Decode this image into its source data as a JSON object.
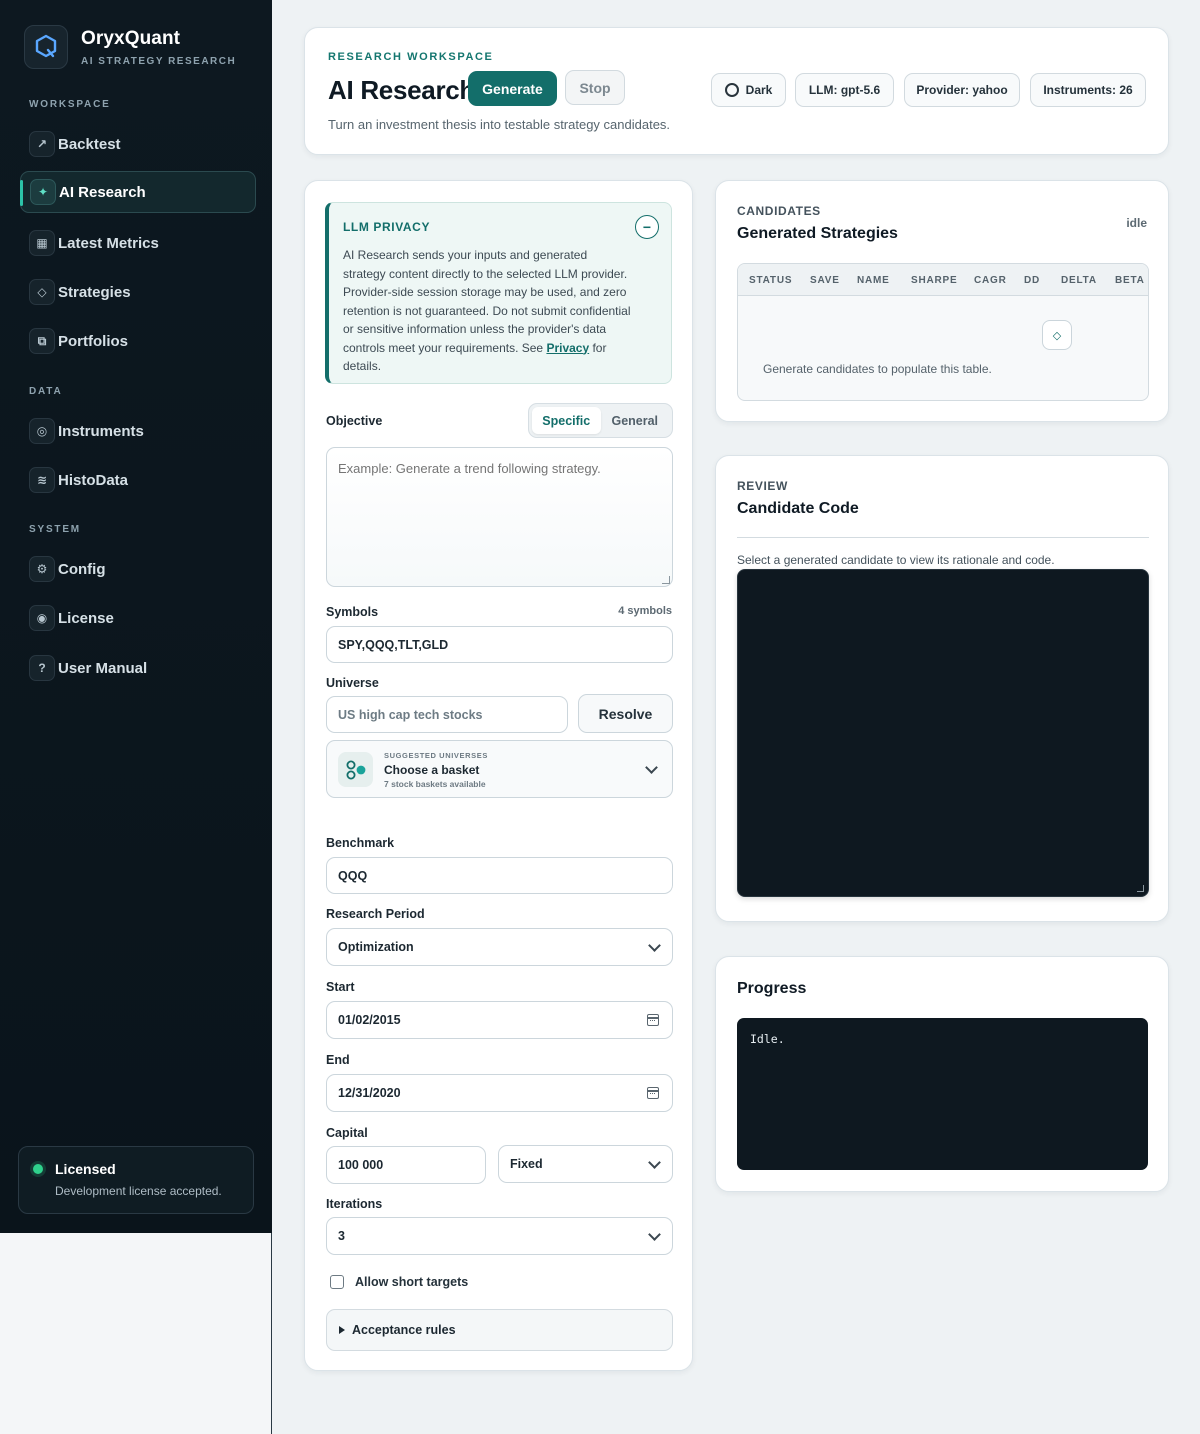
{
  "brand": {
    "name": "OryxQuant",
    "subtitle": "AI STRATEGY RESEARCH"
  },
  "sidebar": {
    "sections": [
      {
        "title": "WORKSPACE"
      },
      {
        "title": "DATA"
      },
      {
        "title": "SYSTEM"
      }
    ],
    "items": [
      {
        "label": "Backtest",
        "icon": "arrow-up-right-icon",
        "glyph": "↗"
      },
      {
        "label": "AI Research",
        "icon": "sparkle-icon",
        "glyph": "✦",
        "active": true
      },
      {
        "label": "Latest Metrics",
        "icon": "grid-icon",
        "glyph": "▦"
      },
      {
        "label": "Strategies",
        "icon": "diamond-icon",
        "glyph": "◇"
      },
      {
        "label": "Portfolios",
        "icon": "layers-icon",
        "glyph": "⧉"
      },
      {
        "label": "Instruments",
        "icon": "target-icon",
        "glyph": "◎"
      },
      {
        "label": "HistoData",
        "icon": "waves-icon",
        "glyph": "≋"
      },
      {
        "label": "Config",
        "icon": "gear-icon",
        "glyph": "⚙"
      },
      {
        "label": "License",
        "icon": "record-icon",
        "glyph": "◉"
      },
      {
        "label": "User Manual",
        "icon": "question-icon",
        "glyph": "?"
      }
    ],
    "license": {
      "title": "Licensed",
      "subtitle": "Development license accepted.",
      "status_color": "#2fd18c"
    }
  },
  "header": {
    "eyebrow": "RESEARCH WORKSPACE",
    "title": "AI Research",
    "generate_label": "Generate",
    "stop_label": "Stop",
    "subtitle": "Turn an investment thesis into testable strategy candidates.",
    "theme_label": "Dark",
    "llm_label": "LLM: gpt-5.6",
    "provider_label": "Provider: yahoo",
    "instruments_label": "Instruments: 26"
  },
  "privacy": {
    "title": "LLM PRIVACY",
    "toggle": "−",
    "body_before": "AI Research sends your inputs and generated strategy content directly to the selected LLM provider. Provider-side session storage may be used, and zero retention is not guaranteed. Do not submit confidential or sensitive information unless the provider's data controls meet your requirements. See ",
    "link": "Privacy",
    "body_after": " for details."
  },
  "form": {
    "objective_label": "Objective",
    "mode_specific": "Specific",
    "mode_general": "General",
    "objective_placeholder": "Example: Generate a trend following strategy.",
    "symbols_label": "Symbols",
    "symbols_count": "4 symbols",
    "symbols_value": "SPY,QQQ,TLT,GLD",
    "universe_label": "Universe",
    "universe_placeholder": "US high cap tech stocks",
    "resolve_label": "Resolve",
    "basket_eyebrow": "SUGGESTED UNIVERSES",
    "basket_title": "Choose a basket",
    "basket_sub": "7 stock baskets available",
    "benchmark_label": "Benchmark",
    "benchmark_value": "QQQ",
    "period_label": "Research Period",
    "period_value": "Optimization",
    "start_label": "Start",
    "start_value": "01/02/2015",
    "end_label": "End",
    "end_value": "12/31/2020",
    "capital_label": "Capital",
    "capital_value": "100 000",
    "capital_mode": "Fixed",
    "iterations_label": "Iterations",
    "iterations_value": "3",
    "short_label": "Allow short targets",
    "acceptance_label": "Acceptance rules"
  },
  "candidates": {
    "eyebrow": "CANDIDATES",
    "title": "Generated Strategies",
    "status": "idle",
    "columns": [
      "STATUS",
      "SAVE",
      "NAME",
      "SHARPE",
      "CAGR",
      "DD",
      "DELTA",
      "BETA"
    ],
    "empty_text": "Generate candidates to populate this table."
  },
  "review": {
    "eyebrow": "REVIEW",
    "title": "Candidate Code",
    "hint": "Select a generated candidate to view its rationale and code."
  },
  "progress": {
    "title": "Progress",
    "log": "Idle."
  },
  "colors": {
    "accent": "#136e6a",
    "sidebar_bg": "#0d1820",
    "active_indicator": "#2cc3a8"
  }
}
